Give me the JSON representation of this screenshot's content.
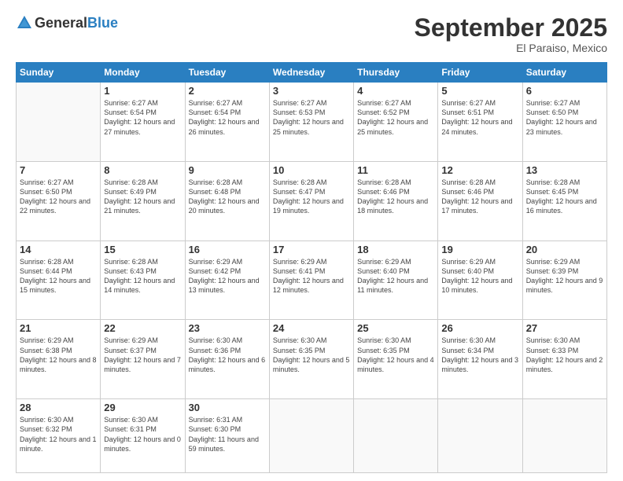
{
  "header": {
    "logo_general": "General",
    "logo_blue": "Blue",
    "month_title": "September 2025",
    "subtitle": "El Paraiso, Mexico"
  },
  "days_of_week": [
    "Sunday",
    "Monday",
    "Tuesday",
    "Wednesday",
    "Thursday",
    "Friday",
    "Saturday"
  ],
  "weeks": [
    [
      {
        "day": "",
        "sunrise": "",
        "sunset": "",
        "daylight": ""
      },
      {
        "day": "1",
        "sunrise": "Sunrise: 6:27 AM",
        "sunset": "Sunset: 6:54 PM",
        "daylight": "Daylight: 12 hours and 27 minutes."
      },
      {
        "day": "2",
        "sunrise": "Sunrise: 6:27 AM",
        "sunset": "Sunset: 6:54 PM",
        "daylight": "Daylight: 12 hours and 26 minutes."
      },
      {
        "day": "3",
        "sunrise": "Sunrise: 6:27 AM",
        "sunset": "Sunset: 6:53 PM",
        "daylight": "Daylight: 12 hours and 25 minutes."
      },
      {
        "day": "4",
        "sunrise": "Sunrise: 6:27 AM",
        "sunset": "Sunset: 6:52 PM",
        "daylight": "Daylight: 12 hours and 25 minutes."
      },
      {
        "day": "5",
        "sunrise": "Sunrise: 6:27 AM",
        "sunset": "Sunset: 6:51 PM",
        "daylight": "Daylight: 12 hours and 24 minutes."
      },
      {
        "day": "6",
        "sunrise": "Sunrise: 6:27 AM",
        "sunset": "Sunset: 6:50 PM",
        "daylight": "Daylight: 12 hours and 23 minutes."
      }
    ],
    [
      {
        "day": "7",
        "sunrise": "Sunrise: 6:27 AM",
        "sunset": "Sunset: 6:50 PM",
        "daylight": "Daylight: 12 hours and 22 minutes."
      },
      {
        "day": "8",
        "sunrise": "Sunrise: 6:28 AM",
        "sunset": "Sunset: 6:49 PM",
        "daylight": "Daylight: 12 hours and 21 minutes."
      },
      {
        "day": "9",
        "sunrise": "Sunrise: 6:28 AM",
        "sunset": "Sunset: 6:48 PM",
        "daylight": "Daylight: 12 hours and 20 minutes."
      },
      {
        "day": "10",
        "sunrise": "Sunrise: 6:28 AM",
        "sunset": "Sunset: 6:47 PM",
        "daylight": "Daylight: 12 hours and 19 minutes."
      },
      {
        "day": "11",
        "sunrise": "Sunrise: 6:28 AM",
        "sunset": "Sunset: 6:46 PM",
        "daylight": "Daylight: 12 hours and 18 minutes."
      },
      {
        "day": "12",
        "sunrise": "Sunrise: 6:28 AM",
        "sunset": "Sunset: 6:46 PM",
        "daylight": "Daylight: 12 hours and 17 minutes."
      },
      {
        "day": "13",
        "sunrise": "Sunrise: 6:28 AM",
        "sunset": "Sunset: 6:45 PM",
        "daylight": "Daylight: 12 hours and 16 minutes."
      }
    ],
    [
      {
        "day": "14",
        "sunrise": "Sunrise: 6:28 AM",
        "sunset": "Sunset: 6:44 PM",
        "daylight": "Daylight: 12 hours and 15 minutes."
      },
      {
        "day": "15",
        "sunrise": "Sunrise: 6:28 AM",
        "sunset": "Sunset: 6:43 PM",
        "daylight": "Daylight: 12 hours and 14 minutes."
      },
      {
        "day": "16",
        "sunrise": "Sunrise: 6:29 AM",
        "sunset": "Sunset: 6:42 PM",
        "daylight": "Daylight: 12 hours and 13 minutes."
      },
      {
        "day": "17",
        "sunrise": "Sunrise: 6:29 AM",
        "sunset": "Sunset: 6:41 PM",
        "daylight": "Daylight: 12 hours and 12 minutes."
      },
      {
        "day": "18",
        "sunrise": "Sunrise: 6:29 AM",
        "sunset": "Sunset: 6:40 PM",
        "daylight": "Daylight: 12 hours and 11 minutes."
      },
      {
        "day": "19",
        "sunrise": "Sunrise: 6:29 AM",
        "sunset": "Sunset: 6:40 PM",
        "daylight": "Daylight: 12 hours and 10 minutes."
      },
      {
        "day": "20",
        "sunrise": "Sunrise: 6:29 AM",
        "sunset": "Sunset: 6:39 PM",
        "daylight": "Daylight: 12 hours and 9 minutes."
      }
    ],
    [
      {
        "day": "21",
        "sunrise": "Sunrise: 6:29 AM",
        "sunset": "Sunset: 6:38 PM",
        "daylight": "Daylight: 12 hours and 8 minutes."
      },
      {
        "day": "22",
        "sunrise": "Sunrise: 6:29 AM",
        "sunset": "Sunset: 6:37 PM",
        "daylight": "Daylight: 12 hours and 7 minutes."
      },
      {
        "day": "23",
        "sunrise": "Sunrise: 6:30 AM",
        "sunset": "Sunset: 6:36 PM",
        "daylight": "Daylight: 12 hours and 6 minutes."
      },
      {
        "day": "24",
        "sunrise": "Sunrise: 6:30 AM",
        "sunset": "Sunset: 6:35 PM",
        "daylight": "Daylight: 12 hours and 5 minutes."
      },
      {
        "day": "25",
        "sunrise": "Sunrise: 6:30 AM",
        "sunset": "Sunset: 6:35 PM",
        "daylight": "Daylight: 12 hours and 4 minutes."
      },
      {
        "day": "26",
        "sunrise": "Sunrise: 6:30 AM",
        "sunset": "Sunset: 6:34 PM",
        "daylight": "Daylight: 12 hours and 3 minutes."
      },
      {
        "day": "27",
        "sunrise": "Sunrise: 6:30 AM",
        "sunset": "Sunset: 6:33 PM",
        "daylight": "Daylight: 12 hours and 2 minutes."
      }
    ],
    [
      {
        "day": "28",
        "sunrise": "Sunrise: 6:30 AM",
        "sunset": "Sunset: 6:32 PM",
        "daylight": "Daylight: 12 hours and 1 minute."
      },
      {
        "day": "29",
        "sunrise": "Sunrise: 6:30 AM",
        "sunset": "Sunset: 6:31 PM",
        "daylight": "Daylight: 12 hours and 0 minutes."
      },
      {
        "day": "30",
        "sunrise": "Sunrise: 6:31 AM",
        "sunset": "Sunset: 6:30 PM",
        "daylight": "Daylight: 11 hours and 59 minutes."
      },
      {
        "day": "",
        "sunrise": "",
        "sunset": "",
        "daylight": ""
      },
      {
        "day": "",
        "sunrise": "",
        "sunset": "",
        "daylight": ""
      },
      {
        "day": "",
        "sunrise": "",
        "sunset": "",
        "daylight": ""
      },
      {
        "day": "",
        "sunrise": "",
        "sunset": "",
        "daylight": ""
      }
    ]
  ]
}
